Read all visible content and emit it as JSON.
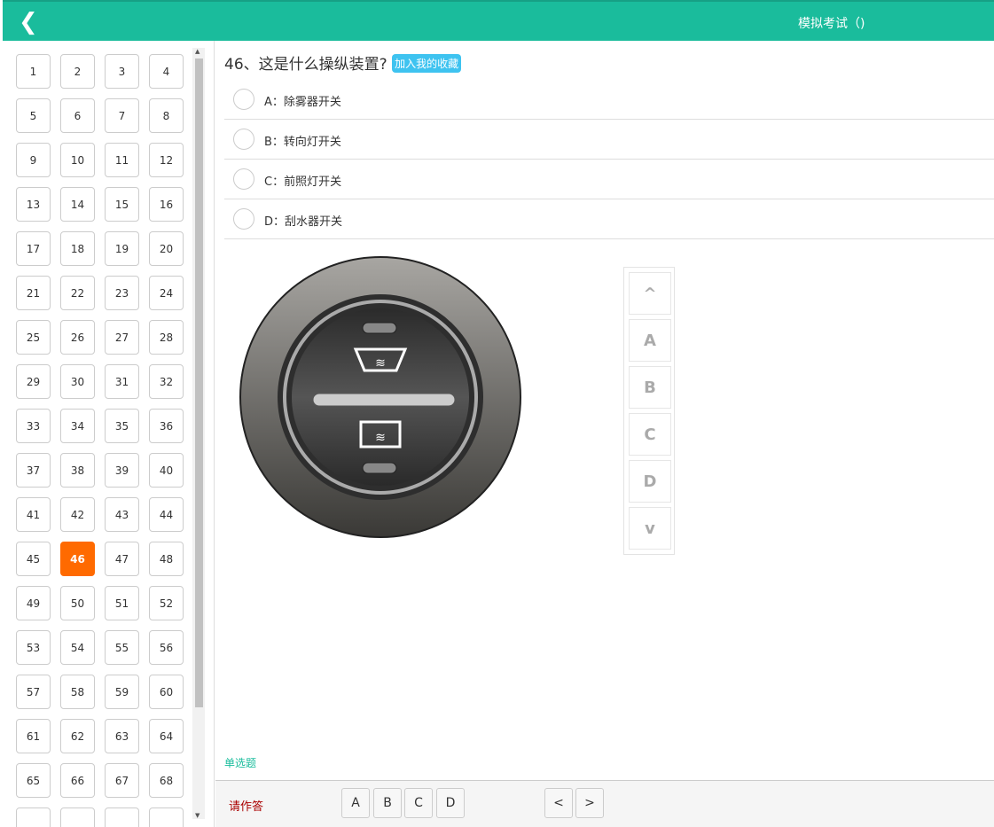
{
  "header": {
    "back_icon": "chevron-left-icon",
    "title": "模拟考试（)"
  },
  "sidebar": {
    "numbers": [
      1,
      2,
      3,
      4,
      5,
      6,
      7,
      8,
      9,
      10,
      11,
      12,
      13,
      14,
      15,
      16,
      17,
      18,
      19,
      20,
      21,
      22,
      23,
      24,
      25,
      26,
      27,
      28,
      29,
      30,
      31,
      32,
      33,
      34,
      35,
      36,
      37,
      38,
      39,
      40,
      41,
      42,
      43,
      44,
      45,
      46,
      47,
      48,
      49,
      50,
      51,
      52,
      53,
      54,
      55,
      56,
      57,
      58,
      59,
      60,
      61,
      62,
      63,
      64,
      65,
      66,
      67,
      68
    ],
    "current": 46
  },
  "question": {
    "text": "46、这是什么操纵装置?",
    "favorite_label": "加入我的收藏",
    "options": [
      {
        "label": "A：除雾器开关"
      },
      {
        "label": "B：转向灯开关"
      },
      {
        "label": "C：前照灯开关"
      },
      {
        "label": "D：刮水器开关"
      }
    ],
    "type": "单选题"
  },
  "side_nav": {
    "up": "^",
    "letters": [
      "A",
      "B",
      "C",
      "D"
    ],
    "down": "v"
  },
  "footer": {
    "hint": "请作答",
    "answers": [
      "A",
      "B",
      "C",
      "D"
    ],
    "prev": "<",
    "next": ">"
  }
}
